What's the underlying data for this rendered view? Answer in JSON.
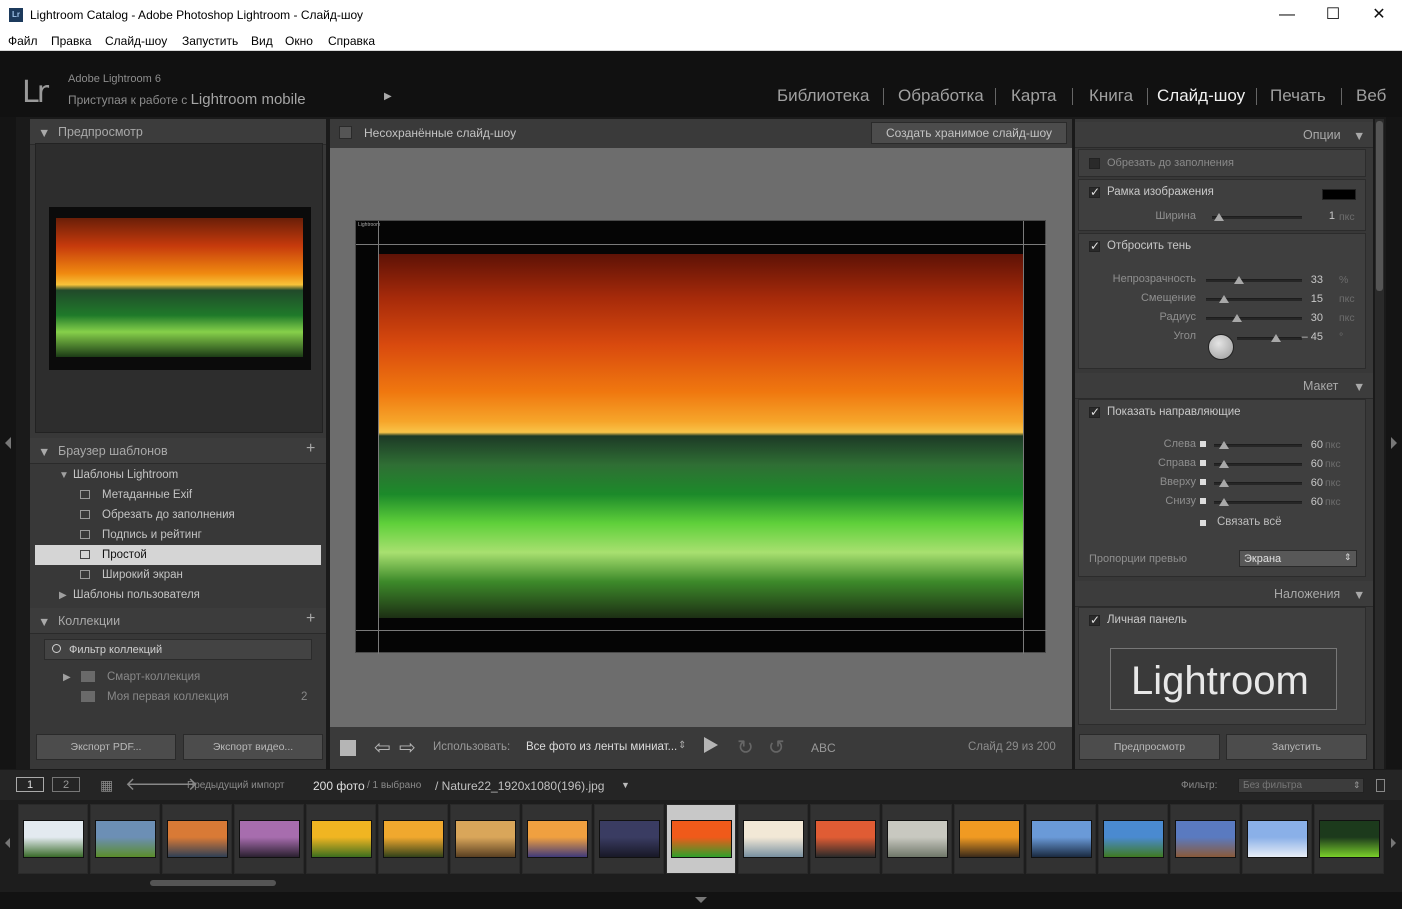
{
  "window": {
    "title": "Lightroom Catalog - Adobe Photoshop Lightroom - Слайд-шоу",
    "icon": "Lr",
    "controls": {
      "minimize": "—",
      "maximize": "☐",
      "close": "✕"
    }
  },
  "menu": [
    "Файл",
    "Правка",
    "Слайд-шоу",
    "Запустить",
    "Вид",
    "Окно",
    "Справка"
  ],
  "identity": {
    "logo": "Lr",
    "version": "Adobe Lightroom 6",
    "getting_started": "Приступая к работе с",
    "mobile": "Lightroom mobile",
    "play": "▶"
  },
  "modules": [
    {
      "label": "Библиотека",
      "active": false
    },
    {
      "label": "Обработка",
      "active": false
    },
    {
      "label": "Карта",
      "active": false
    },
    {
      "label": "Книга",
      "active": false
    },
    {
      "label": "Слайд-шоу",
      "active": true
    },
    {
      "label": "Печать",
      "active": false
    },
    {
      "label": "Веб",
      "active": false
    }
  ],
  "left": {
    "preview_title": "Предпросмотр",
    "template_browser": "Браузер шаблонов",
    "template_group": "Шаблоны Lightroom",
    "templates": [
      {
        "label": "Метаданные Exif",
        "selected": false
      },
      {
        "label": "Обрезать до заполнения",
        "selected": false
      },
      {
        "label": "Подпись и рейтинг",
        "selected": false
      },
      {
        "label": "Простой",
        "selected": true
      },
      {
        "label": "Широкий экран",
        "selected": false
      }
    ],
    "user_templates": "Шаблоны пользователя",
    "collections_title": "Коллекции",
    "collection_filter": "Фильтр коллекций",
    "collections": [
      {
        "label": "Смарт-коллекция",
        "count": ""
      },
      {
        "label": "Моя первая коллекция",
        "count": "2"
      }
    ],
    "export_pdf": "Экспорт PDF...",
    "export_video": "Экспорт видео...",
    "plus": "+"
  },
  "center": {
    "title": "Несохранённые слайд-шоу",
    "create_button": "Создать хранимое слайд-шоу",
    "identity_plate_small": "Lightroom",
    "use_label": "Использовать:",
    "use_value": "Все фото из ленты миниат...",
    "abc": "ABC",
    "slide_counter": "Слайд 29 из 200"
  },
  "right": {
    "options_title": "Опции",
    "crop_fill": "Обрезать до заполнения",
    "image_border": "Рамка изображения",
    "border_width": {
      "label": "Ширина",
      "value": "1",
      "unit": "пкс",
      "level": 0.02
    },
    "cast_shadow": "Отбросить тень",
    "shadow": [
      {
        "label": "Непрозрачность",
        "value": "33",
        "unit": "%",
        "level": 0.33
      },
      {
        "label": "Смещение",
        "value": "15",
        "unit": "пкс",
        "level": 0.15
      },
      {
        "label": "Радиус",
        "value": "30",
        "unit": "пкс",
        "level": 0.3
      },
      {
        "label": "Угол",
        "value": "– 45",
        "unit": "°",
        "level": 0.62
      }
    ],
    "layout_title": "Макет",
    "show_guides": "Показать направляющие",
    "margins": [
      {
        "label": "Слева",
        "value": "60",
        "unit": "пкс",
        "level": 0.06
      },
      {
        "label": "Справа",
        "value": "60",
        "unit": "пкс",
        "level": 0.06
      },
      {
        "label": "Вверху",
        "value": "60",
        "unit": "пкс",
        "level": 0.06
      },
      {
        "label": "Снизу",
        "value": "60",
        "unit": "пкс",
        "level": 0.06
      }
    ],
    "link_all": "Связать всё",
    "aspect_label": "Пропорции превью",
    "aspect_value": "Экрана",
    "overlays_title": "Наложения",
    "identity_plate_check": "Личная панель",
    "identity_plate_text": "Lightroom",
    "preview_button": "Предпросмотр",
    "play_button": "Запустить"
  },
  "filmstrip": {
    "views": [
      "1",
      "2"
    ],
    "source": "Предыдущий импорт",
    "count": "200 фото",
    "selected": "/ 1 выбрано",
    "filename": "/ Nature22_1920x1080(196).jpg",
    "filter_label": "Фильтр:",
    "filter_value": "Без фильтра",
    "thumbs": [
      {
        "name": "birch-forest",
        "c1": "#e3eaf0",
        "c2": "#3a6b2a"
      },
      {
        "name": "green-field",
        "c1": "#6c8fb5",
        "c2": "#5b8d2a"
      },
      {
        "name": "sunset-coast",
        "c1": "#d97a36",
        "c2": "#2f3f55"
      },
      {
        "name": "purple-shore",
        "c1": "#a76dae",
        "c2": "#2b2030"
      },
      {
        "name": "sunflower-sun",
        "c1": "#f0b522",
        "c2": "#3d6f1e"
      },
      {
        "name": "tree-sunset",
        "c1": "#f0a82e",
        "c2": "#32421a"
      },
      {
        "name": "desert-dusk",
        "c1": "#d9a65a",
        "c2": "#5a4022"
      },
      {
        "name": "violet-sky",
        "c1": "#f0a040",
        "c2": "#403a7a"
      },
      {
        "name": "lightning",
        "c1": "#3a3c62",
        "c2": "#181826"
      },
      {
        "name": "green-wave",
        "c1": "#f05a1a",
        "c2": "#2fa02a",
        "selected": true
      },
      {
        "name": "clouds-mountain",
        "c1": "#f2e8d6",
        "c2": "#7890a0"
      },
      {
        "name": "red-clouds",
        "c1": "#e05c34",
        "c2": "#2a2a2a"
      },
      {
        "name": "foggy-hills",
        "c1": "#c8c8c0",
        "c2": "#70786a"
      },
      {
        "name": "orange-horizon",
        "c1": "#f09a22",
        "c2": "#3a2a1a"
      },
      {
        "name": "blue-trees",
        "c1": "#6a9ad8",
        "c2": "#1a2a40"
      },
      {
        "name": "green-road",
        "c1": "#4a8ad0",
        "c2": "#3f7a22"
      },
      {
        "name": "rocky-beach",
        "c1": "#5a7ac0",
        "c2": "#8a5a3a"
      },
      {
        "name": "frost-tree",
        "c1": "#8ab0e8",
        "c2": "#e8eef6"
      },
      {
        "name": "aurora",
        "c1": "#1c3a1c",
        "c2": "#7ad02a"
      }
    ]
  }
}
